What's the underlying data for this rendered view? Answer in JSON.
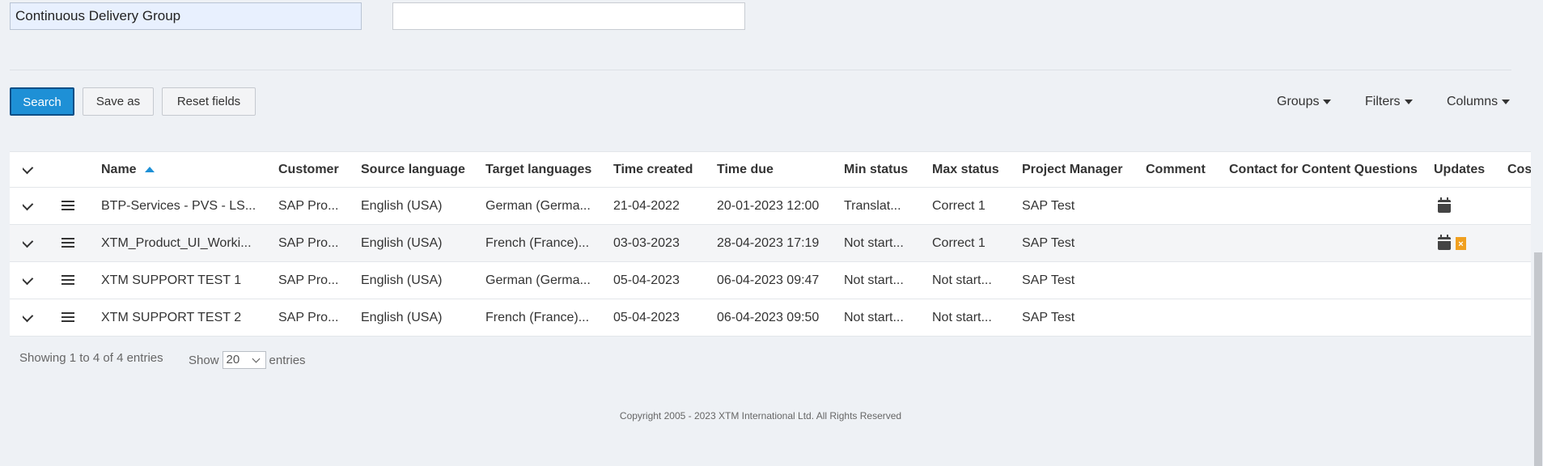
{
  "form": {
    "group_value": "Continuous Delivery Group",
    "second_value": ""
  },
  "toolbar": {
    "search_label": "Search",
    "saveas_label": "Save as",
    "reset_label": "Reset fields",
    "groups_label": "Groups",
    "filters_label": "Filters",
    "columns_label": "Columns"
  },
  "table": {
    "headers": {
      "name": "Name",
      "customer": "Customer",
      "source": "Source language",
      "target": "Target languages",
      "created": "Time created",
      "due": "Time due",
      "min_status": "Min status",
      "max_status": "Max status",
      "pm": "Project Manager",
      "comment": "Comment",
      "contact": "Contact for Content Questions",
      "updates": "Updates",
      "cost": "Cos"
    },
    "rows": [
      {
        "name": "BTP-Services - PVS - LS...",
        "customer": "SAP Pro...",
        "source": "English (USA)",
        "target": "German (Germa...",
        "created": "21-04-2022",
        "due": "20-01-2023 12:00",
        "min_status": "Translat...",
        "max_status": "Correct 1",
        "pm": "SAP Test",
        "comment": "",
        "contact": ""
      },
      {
        "name": "XTM_Product_UI_Worki...",
        "customer": "SAP Pro...",
        "source": "English (USA)",
        "target": "French (France)...",
        "created": "03-03-2023",
        "due": "28-04-2023 17:19",
        "min_status": "Not start...",
        "max_status": "Correct 1",
        "pm": "SAP Test",
        "comment": "",
        "contact": ""
      },
      {
        "name": "XTM SUPPORT TEST 1",
        "customer": "SAP Pro...",
        "source": "English (USA)",
        "target": "German (Germa...",
        "created": "05-04-2023",
        "due": "06-04-2023 09:47",
        "min_status": "Not start...",
        "max_status": "Not start...",
        "pm": "SAP Test",
        "comment": "",
        "contact": ""
      },
      {
        "name": "XTM SUPPORT TEST 2",
        "customer": "SAP Pro...",
        "source": "English (USA)",
        "target": "French (France)...",
        "created": "05-04-2023",
        "due": "06-04-2023 09:50",
        "min_status": "Not start...",
        "max_status": "Not start...",
        "pm": "SAP Test",
        "comment": "",
        "contact": ""
      }
    ]
  },
  "pagination": {
    "summary": "Showing 1 to 4 of 4 entries",
    "show_label": "Show",
    "page_size": "20",
    "entries_label": "entries"
  },
  "footer": {
    "copyright": "Copyright 2005 - 2023 XTM International Ltd. All Rights Reserved"
  },
  "icons": {
    "calendar": "calendar-icon",
    "file": "file-error-icon",
    "menu": "menu-icon",
    "expand": "chevron-down-icon"
  },
  "colors": {
    "primary": "#1e90d6",
    "background": "#eef1f5",
    "file_icon": "#f0a020"
  }
}
